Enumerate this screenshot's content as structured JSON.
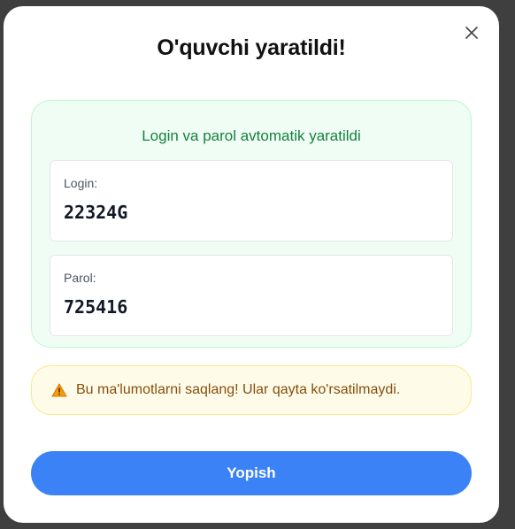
{
  "modal": {
    "title": "O'quvchi yaratildi!",
    "close_icon": "close-icon"
  },
  "credentials": {
    "heading": "Login va parol avtomatik yaratildi",
    "login_label": "Login:",
    "login_value": "22324G",
    "parol_label": "Parol:",
    "parol_value": "725416"
  },
  "warning": {
    "icon": "warning-icon",
    "text": "Bu ma'lumotlarni saqlang! Ular qayta ko'rsatilmaydi."
  },
  "actions": {
    "close_label": "Yopish"
  },
  "colors": {
    "primary": "#3b82f6",
    "success_bg": "#f0fdf4",
    "success_text": "#15803d",
    "warning_bg": "#fefce8",
    "warning_text": "#854d0e"
  }
}
